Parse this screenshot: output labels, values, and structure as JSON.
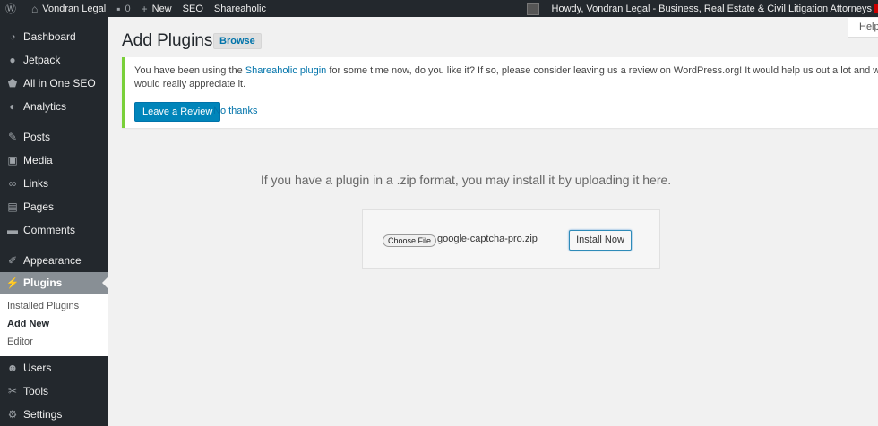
{
  "adminbar": {
    "site_name": "Vondran Legal",
    "comments_count": "0",
    "new_label": "New",
    "seo_label": "SEO",
    "shareaholic_label": "Shareaholic",
    "howdy": "Howdy, Vondran Legal - Business, Real Estate & Civil Litigation Attorneys"
  },
  "sidebar": {
    "items": [
      {
        "label": "Dashboard",
        "icon": "dashboard-icon"
      },
      {
        "label": "Jetpack",
        "icon": "jetpack-icon"
      },
      {
        "label": "All in One SEO",
        "icon": "shield-icon"
      },
      {
        "label": "Analytics",
        "icon": "analytics-icon"
      },
      {
        "label": "Posts",
        "icon": "pin-icon"
      },
      {
        "label": "Media",
        "icon": "media-icon"
      },
      {
        "label": "Links",
        "icon": "link-icon"
      },
      {
        "label": "Pages",
        "icon": "page-icon"
      },
      {
        "label": "Comments",
        "icon": "comment-icon"
      },
      {
        "label": "Appearance",
        "icon": "brush-icon"
      },
      {
        "label": "Plugins",
        "icon": "plug-icon"
      },
      {
        "label": "Users",
        "icon": "user-icon"
      },
      {
        "label": "Tools",
        "icon": "wrench-icon"
      },
      {
        "label": "Settings",
        "icon": "settings-icon"
      }
    ],
    "submenu": [
      "Installed Plugins",
      "Add New",
      "Editor"
    ]
  },
  "main": {
    "title": "Add Plugins",
    "browse_label": "Browse",
    "help_label": "Help",
    "notice": {
      "text_before": "You have been using the ",
      "link_text": "Shareaholic plugin",
      "text_after": " for some time now, do you like it? If so, please consider leaving us a review on WordPress.org! It would help us out a lot and we would really appreciate it.",
      "review_button": "Leave a Review",
      "no_thanks": "No thanks"
    },
    "upload": {
      "help_text": "If you have a plugin in a .zip format, you may install it by uploading it here.",
      "choose_file_label": "Choose File",
      "file_name": "google-captcha-pro.zip",
      "install_label": "Install Now"
    }
  },
  "colors": {
    "admin_dark": "#23282d",
    "accent_blue": "#0073aa",
    "button_blue": "#0085ba",
    "notice_green": "#7ad03a",
    "current_menu": "#888f95"
  }
}
